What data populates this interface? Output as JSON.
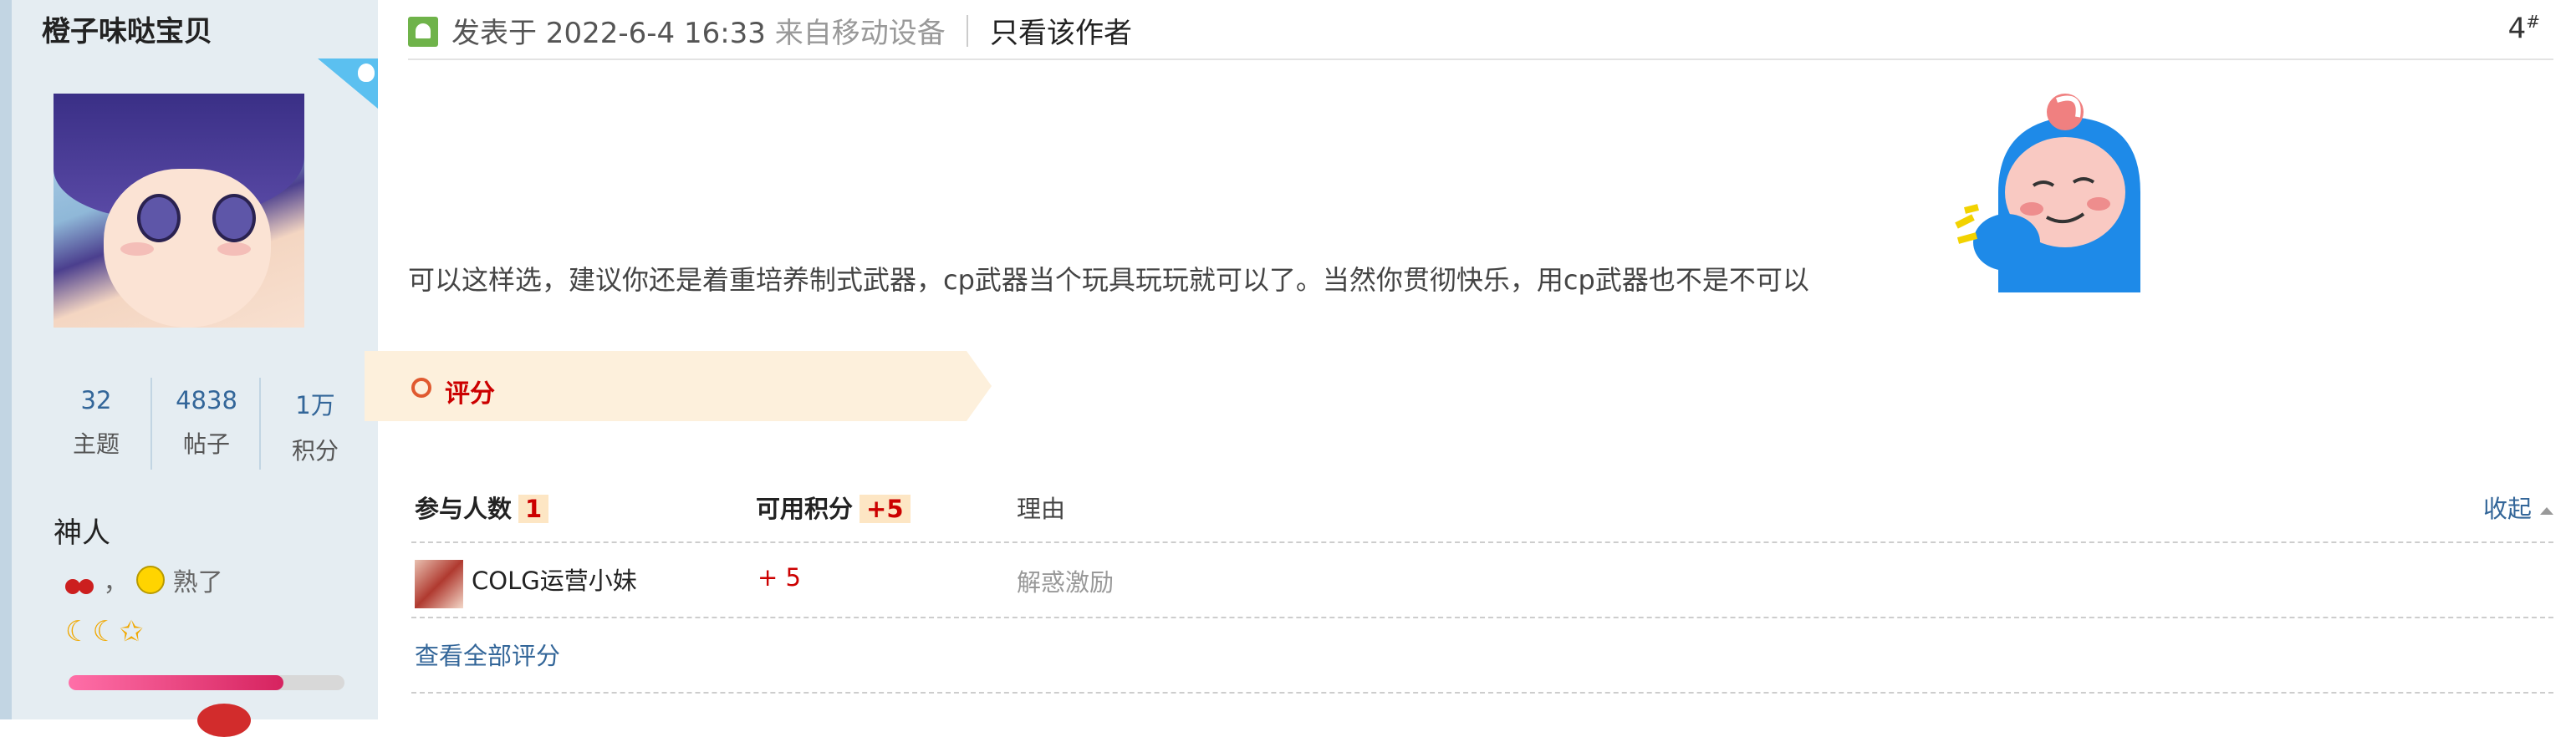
{
  "sidebar": {
    "username": "橙子味哒宝贝",
    "stats": [
      {
        "value": "32",
        "label": "主题"
      },
      {
        "value": "4838",
        "label": "帖子"
      },
      {
        "value": "1万",
        "label": "积分"
      }
    ],
    "rank": "神人",
    "medal_text": "熟了",
    "medal_sep": "，",
    "stars": "☾☾✩",
    "progress": 0.78
  },
  "post": {
    "posted_prefix": "发表于 2022-6-4 16:33",
    "from_device": "来自移动设备",
    "only_author": "只看该作者",
    "floor": "4",
    "floor_sup": "#",
    "content": "可以这样选，建议你还是着重培养制式武器，cp武器当个玩具玩玩就可以了。当然你贯彻快乐，用cp武器也不是不可以"
  },
  "rating": {
    "tab_label": "评分",
    "header": {
      "participants_label": "参与人数",
      "participants_count": "1",
      "points_label": "可用积分",
      "points_value": "+5",
      "reason_label": "理由",
      "collapse_label": "收起"
    },
    "rows": [
      {
        "user": "COLG运营小妹",
        "score": "+ 5",
        "reason": "解惑激励"
      }
    ],
    "view_all": "查看全部评分"
  },
  "colors": {
    "sidebar_bg": "#e5edf2",
    "link": "#336699",
    "accent_red": "#cc0000",
    "rate_tab_bg": "#fdf0dc"
  }
}
